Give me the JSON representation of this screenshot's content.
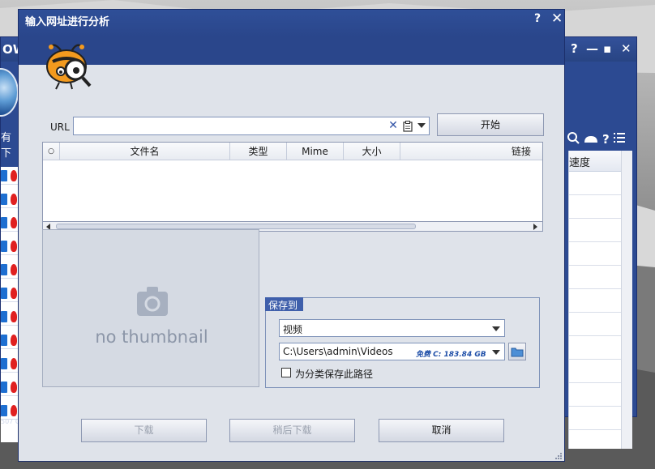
{
  "background_window": {
    "title": "OWI",
    "controls": [
      "?",
      "—",
      "▪",
      "✕"
    ],
    "left_header": "有下",
    "right_header": "速度",
    "footer_text": "507 G"
  },
  "dialog": {
    "title": "输入网址进行分析",
    "help": "?",
    "close": "✕",
    "url_label": "URL",
    "url_value": "",
    "start_button": "开始",
    "table": {
      "columns": [
        "○",
        "文件名",
        "类型",
        "Mime",
        "大小",
        "链接"
      ]
    },
    "thumbnail_text": "no thumbnail",
    "save_group": {
      "label": "保存到",
      "type_value": "视频",
      "path_value": "C:\\Users\\admin\\Videos",
      "free_space": "免费 C: 183.84 GB",
      "checkbox_label": "为分类保存此路径"
    },
    "buttons": {
      "download": "下载",
      "download_later": "稍后下载",
      "cancel": "取消"
    }
  },
  "colors": {
    "titlebar": "#2a468b",
    "dialog_bg": "#dfe3ea",
    "accent": "#3f5fab"
  }
}
